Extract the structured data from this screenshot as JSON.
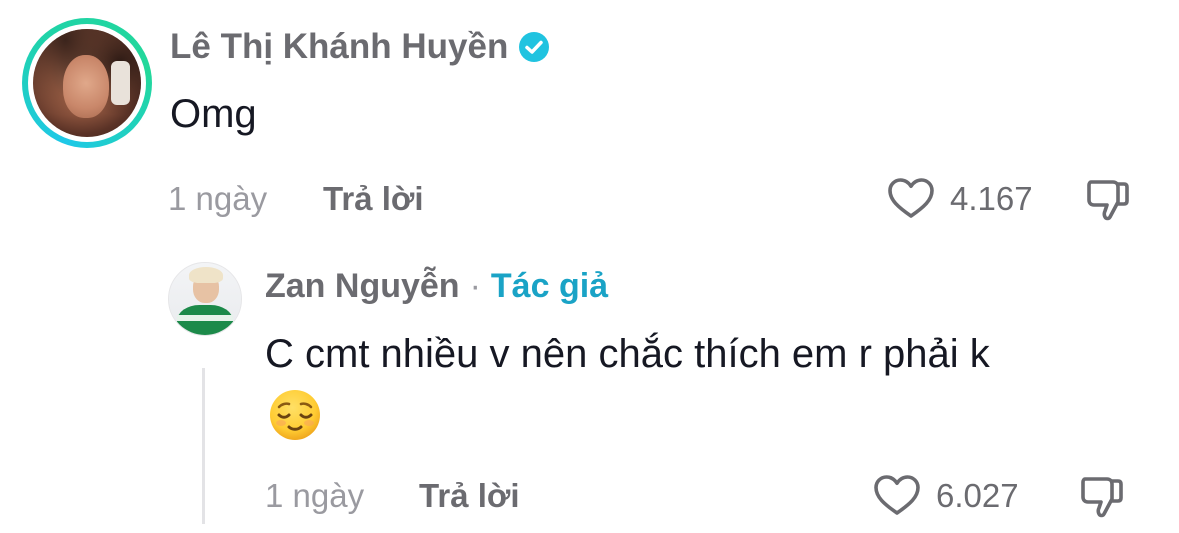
{
  "comments": [
    {
      "author": "Lê Thị Khánh Huyền",
      "verified": true,
      "text": "Omg",
      "time": "1 ngày",
      "reply_label": "Trả lời",
      "likes": "4.167"
    }
  ],
  "replies": [
    {
      "author": "Zan Nguyễn",
      "separator": "·",
      "author_badge": "Tác giả",
      "text": "C cmt nhiều v nên chắc thích em r phải k",
      "emoji": "relieved-face-emoji",
      "time": "1 ngày",
      "reply_label": "Trả lời",
      "likes": "6.027"
    }
  ],
  "colors": {
    "verified": "#20C3E0",
    "author_badge": "#1AA3C6",
    "ring_start": "#1EC8E8",
    "ring_end": "#22D89A",
    "muted_text": "#9A9AA0",
    "secondary_text": "#6B6B70",
    "primary_text": "#161823"
  }
}
